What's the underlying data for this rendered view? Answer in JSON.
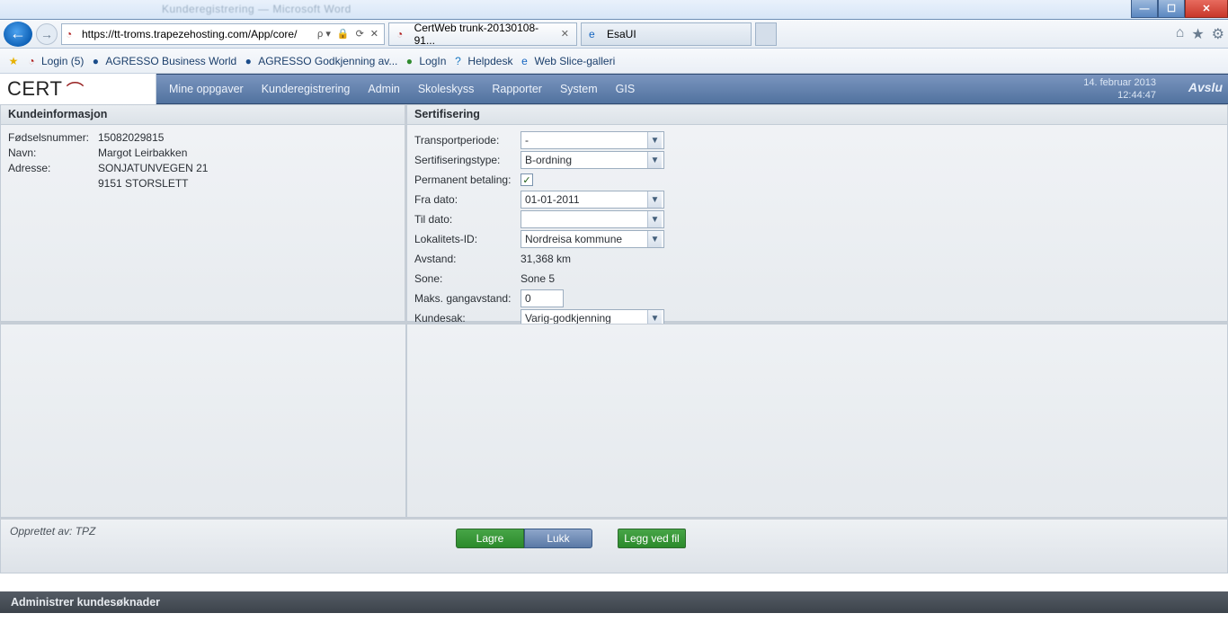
{
  "window": {
    "blurred_title": "Kunderegistrering — Microsoft Word"
  },
  "browser": {
    "url": "https://tt-troms.trapezehosting.com/App/core/",
    "search_hint": "ρ",
    "tabs": [
      {
        "title": "CertWeb trunk-20130108-91...",
        "favicon": "cert"
      },
      {
        "title": "EsaUI",
        "favicon": "ie"
      }
    ],
    "favorites": [
      {
        "label": "Login (5)",
        "icon": "cert"
      },
      {
        "label": "AGRESSO Business World",
        "icon": "globe"
      },
      {
        "label": "AGRESSO Godkjenning av...",
        "icon": "globe"
      },
      {
        "label": "LogIn",
        "icon": "globe-green"
      },
      {
        "label": "Helpdesk",
        "icon": "help"
      },
      {
        "label": "Web Slice-galleri",
        "icon": "ie"
      }
    ]
  },
  "app": {
    "logo": "CERT",
    "nav": [
      "Mine oppgaver",
      "Kunderegistrering",
      "Admin",
      "Skoleskyss",
      "Rapporter",
      "System",
      "GIS"
    ],
    "date": "14. februar 2013",
    "time": "12:44:47",
    "logout": "Avslu"
  },
  "customer_panel": {
    "title": "Kundeinformasjon",
    "rows": {
      "fodselsnummer_label": "Fødselsnummer:",
      "fodselsnummer_value": "15082029815",
      "navn_label": "Navn:",
      "navn_value": "Margot Leirbakken",
      "adresse_label": "Adresse:",
      "adresse_line1": "SONJATUNVEGEN  21",
      "adresse_line2": "9151 STORSLETT"
    }
  },
  "cert_panel": {
    "title": "Sertifisering",
    "transportperiode_label": "Transportperiode:",
    "transportperiode_value": "-",
    "serttype_label": "Sertifiseringstype:",
    "serttype_value": "B-ordning",
    "permanent_label": "Permanent betaling:",
    "permanent_checked": true,
    "fra_label": "Fra dato:",
    "fra_value": "01-01-2011",
    "til_label": "Til dato:",
    "til_value": "",
    "lokalitet_label": "Lokalitets-ID:",
    "lokalitet_value": "Nordreisa kommune",
    "avstand_label": "Avstand:",
    "avstand_value": "31,368 km",
    "sone_label": "Sone:",
    "sone_value": "Sone 5",
    "maks_label": "Maks. gangavstand:",
    "maks_value": "0",
    "kundesak_label": "Kundesak:",
    "kundesak_value": "Varig-godkjenning"
  },
  "footer": {
    "created_by": "Opprettet av: TPZ",
    "save": "Lagre",
    "close": "Lukk",
    "attach": "Legg ved fil"
  },
  "taskbar": {
    "label": "Administrer kundesøknader"
  }
}
